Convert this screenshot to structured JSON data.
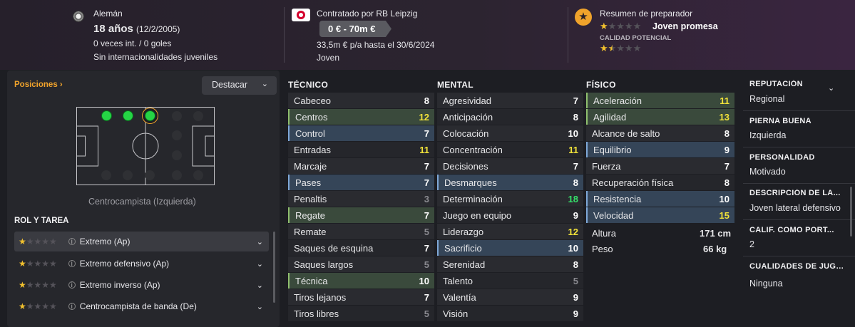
{
  "header": {
    "nationality": "Alemán",
    "age": "18 años",
    "dob": "(12/2/2005)",
    "caps": "0 veces int. / 0 goles",
    "youth_caps": "Sin internacionalidades juveniles",
    "contract_label": "Contratado por RB Leipzig",
    "value": "0 € - 70m €",
    "wage": "33,5m € p/a hasta el 30/6/2024",
    "contract_type": "Joven",
    "coach_label": "Resumen de preparador",
    "coach_summary": "Joven promesa",
    "potential_label": "CALIDAD POTENCIAL",
    "current_stars": 1,
    "potential_stars": 2.5
  },
  "positions": {
    "title": "Posiciones",
    "highlight_btn": "Destacar",
    "position_name": "Centrocampista (Izquierda)"
  },
  "roles": {
    "title": "ROL Y TAREA",
    "items": [
      {
        "name": "Extremo (Ap)",
        "stars": 1
      },
      {
        "name": "Extremo defensivo (Ap)",
        "stars": 1
      },
      {
        "name": "Extremo inverso (Ap)",
        "stars": 1
      },
      {
        "name": "Centrocampista de banda (De)",
        "stars": 1
      }
    ]
  },
  "technical": {
    "title": "TÉCNICO",
    "attrs": [
      {
        "n": "Cabeceo",
        "v": "8",
        "c": "w",
        "h": ""
      },
      {
        "n": "Centros",
        "v": "12",
        "c": "y",
        "h": "g"
      },
      {
        "n": "Control",
        "v": "7",
        "c": "w",
        "h": "b"
      },
      {
        "n": "Entradas",
        "v": "11",
        "c": "y",
        "h": ""
      },
      {
        "n": "Marcaje",
        "v": "7",
        "c": "w",
        "h": ""
      },
      {
        "n": "Pases",
        "v": "7",
        "c": "w",
        "h": "b"
      },
      {
        "n": "Penaltis",
        "v": "3",
        "c": "d",
        "h": ""
      },
      {
        "n": "Regate",
        "v": "7",
        "c": "w",
        "h": "g"
      },
      {
        "n": "Remate",
        "v": "5",
        "c": "d",
        "h": ""
      },
      {
        "n": "Saques de esquina",
        "v": "7",
        "c": "w",
        "h": ""
      },
      {
        "n": "Saques largos",
        "v": "5",
        "c": "d",
        "h": ""
      },
      {
        "n": "Técnica",
        "v": "10",
        "c": "w",
        "h": "g"
      },
      {
        "n": "Tiros lejanos",
        "v": "7",
        "c": "w",
        "h": ""
      },
      {
        "n": "Tiros libres",
        "v": "5",
        "c": "d",
        "h": ""
      }
    ]
  },
  "mental": {
    "title": "MENTAL",
    "attrs": [
      {
        "n": "Agresividad",
        "v": "7",
        "c": "w",
        "h": ""
      },
      {
        "n": "Anticipación",
        "v": "8",
        "c": "w",
        "h": ""
      },
      {
        "n": "Colocación",
        "v": "10",
        "c": "w",
        "h": ""
      },
      {
        "n": "Concentración",
        "v": "11",
        "c": "y",
        "h": ""
      },
      {
        "n": "Decisiones",
        "v": "7",
        "c": "w",
        "h": ""
      },
      {
        "n": "Desmarques",
        "v": "8",
        "c": "w",
        "h": "b"
      },
      {
        "n": "Determinación",
        "v": "18",
        "c": "gr",
        "h": ""
      },
      {
        "n": "Juego en equipo",
        "v": "9",
        "c": "w",
        "h": ""
      },
      {
        "n": "Liderazgo",
        "v": "12",
        "c": "y",
        "h": ""
      },
      {
        "n": "Sacrificio",
        "v": "10",
        "c": "w",
        "h": "b"
      },
      {
        "n": "Serenidad",
        "v": "8",
        "c": "w",
        "h": ""
      },
      {
        "n": "Talento",
        "v": "5",
        "c": "d",
        "h": ""
      },
      {
        "n": "Valentía",
        "v": "9",
        "c": "w",
        "h": ""
      },
      {
        "n": "Visión",
        "v": "9",
        "c": "w",
        "h": ""
      }
    ]
  },
  "physical": {
    "title": "FÍSICO",
    "attrs": [
      {
        "n": "Aceleración",
        "v": "11",
        "c": "y",
        "h": "g"
      },
      {
        "n": "Agilidad",
        "v": "13",
        "c": "y",
        "h": "g"
      },
      {
        "n": "Alcance de salto",
        "v": "8",
        "c": "w",
        "h": ""
      },
      {
        "n": "Equilibrio",
        "v": "9",
        "c": "w",
        "h": "b"
      },
      {
        "n": "Fuerza",
        "v": "7",
        "c": "w",
        "h": ""
      },
      {
        "n": "Recuperación física",
        "v": "8",
        "c": "w",
        "h": ""
      },
      {
        "n": "Resistencia",
        "v": "10",
        "c": "w",
        "h": "b"
      },
      {
        "n": "Velocidad",
        "v": "15",
        "c": "y",
        "h": "b"
      }
    ],
    "height_label": "Altura",
    "height": "171 cm",
    "weight_label": "Peso",
    "weight": "66 kg"
  },
  "info": [
    {
      "label": "REPUTACIÓN",
      "value": "Regional"
    },
    {
      "label": "PIERNA BUENA",
      "value": "Izquierda"
    },
    {
      "label": "PERSONALIDAD",
      "value": "Motivado"
    },
    {
      "label": "DESCRIPCIÓN DE LA...",
      "value": "Joven lateral defensivo"
    },
    {
      "label": "CALIF. COMO PORT...",
      "value": "2"
    },
    {
      "label": "CUALIDADES DE JUGA...",
      "value": "Ninguna"
    }
  ],
  "colors": {
    "accent": "#f0a32b",
    "good": "#25d445",
    "yellow": "#f2e33a"
  }
}
